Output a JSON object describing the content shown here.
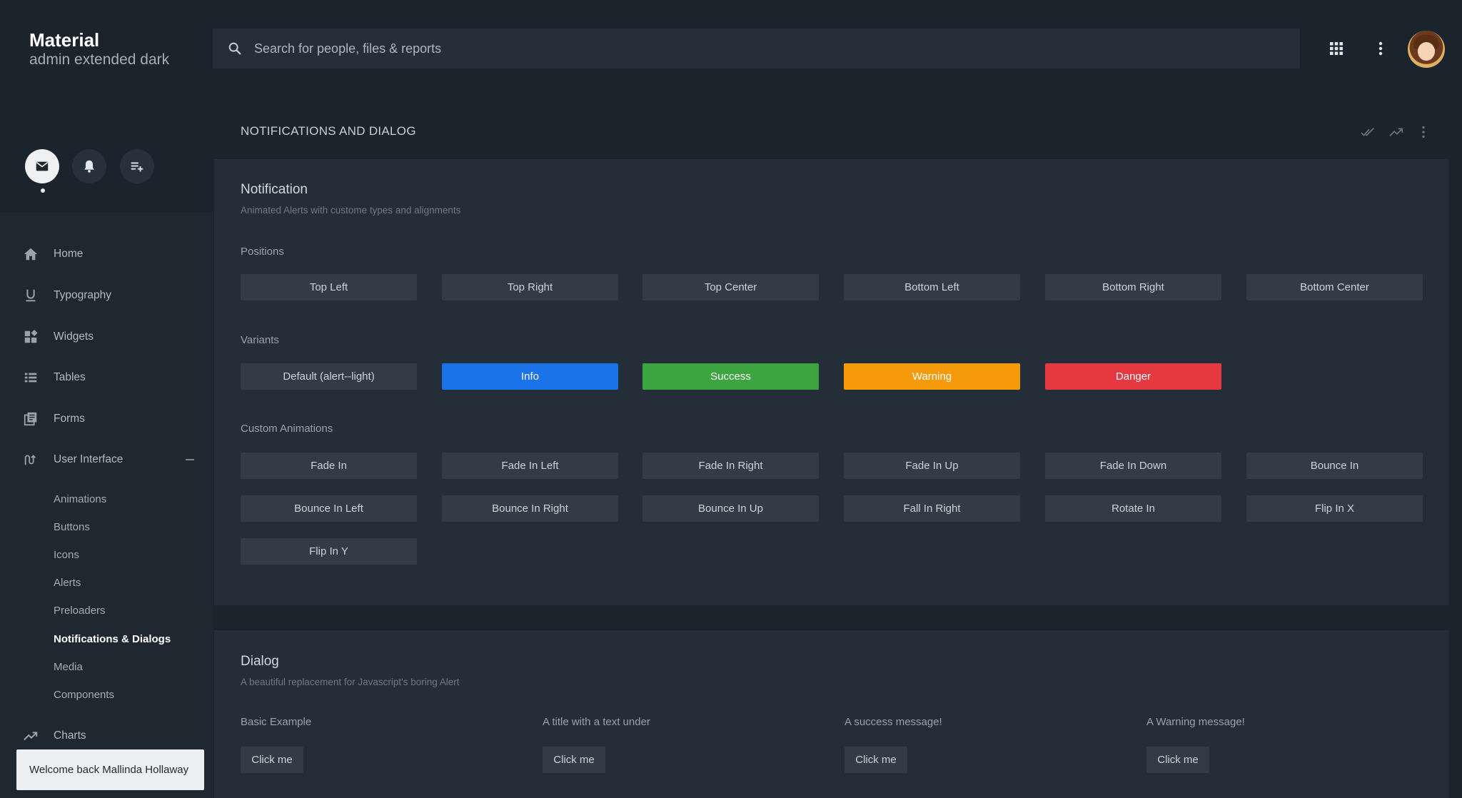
{
  "brand": {
    "title": "Material",
    "subtitle": "admin extended dark"
  },
  "search": {
    "placeholder": "Search for people, files & reports"
  },
  "toolbar": {
    "icons": [
      "apps-grid-icon",
      "more-vert-icon",
      "avatar"
    ]
  },
  "quick_actions": [
    "mail-icon",
    "bell-icon",
    "playlist-add-icon"
  ],
  "sidebar": {
    "items": [
      {
        "label": "Home",
        "icon": "home-icon"
      },
      {
        "label": "Typography",
        "icon": "underline-icon"
      },
      {
        "label": "Widgets",
        "icon": "widgets-icon"
      },
      {
        "label": "Tables",
        "icon": "list-icon"
      },
      {
        "label": "Forms",
        "icon": "forms-icon"
      },
      {
        "label": "User Interface",
        "icon": "gesture-icon",
        "expanded": true
      },
      {
        "label": "Charts",
        "icon": "trending-up-icon"
      }
    ],
    "sub_items": [
      {
        "label": "Animations"
      },
      {
        "label": "Buttons"
      },
      {
        "label": "Icons"
      },
      {
        "label": "Alerts"
      },
      {
        "label": "Preloaders"
      },
      {
        "label": "Notifications & Dialogs",
        "active": true
      },
      {
        "label": "Media"
      },
      {
        "label": "Components"
      }
    ]
  },
  "toast": {
    "text": "Welcome back Mallinda Hollaway"
  },
  "page": {
    "title": "NOTIFICATIONS AND DIALOG",
    "header_icons": [
      "done-all-icon",
      "trending-up-icon",
      "more-vert-icon"
    ]
  },
  "notification": {
    "title": "Notification",
    "subtitle": "Animated Alerts with custome types and alignments",
    "positions_label": "Positions",
    "positions": [
      "Top Left",
      "Top Right",
      "Top Center",
      "Bottom Left",
      "Bottom Right",
      "Bottom Center"
    ],
    "variants_label": "Variants",
    "variants": [
      {
        "label": "Default (alert--light)",
        "color": "#323c46"
      },
      {
        "label": "Info",
        "color": "#1a73e8"
      },
      {
        "label": "Success",
        "color": "#3da53f"
      },
      {
        "label": "Warning",
        "color": "#f59a0b"
      },
      {
        "label": "Danger",
        "color": "#e6383f"
      }
    ],
    "animations_label": "Custom Animations",
    "animations": [
      "Fade In",
      "Fade In Left",
      "Fade In Right",
      "Fade In Up",
      "Fade In Down",
      "Bounce In",
      "Bounce In Left",
      "Bounce In Right",
      "Bounce In Up",
      "Fall In Right",
      "Rotate In",
      "Flip In X",
      "Flip In Y"
    ]
  },
  "dialog": {
    "title": "Dialog",
    "subtitle": "A beautiful replacement for Javascript's boring Alert",
    "examples": [
      {
        "label": "Basic Example",
        "button": "Click me"
      },
      {
        "label": "A title with a text under",
        "button": "Click me"
      },
      {
        "label": "A success message!",
        "button": "Click me"
      },
      {
        "label": "A Warning message!",
        "button": "Click me"
      }
    ]
  }
}
